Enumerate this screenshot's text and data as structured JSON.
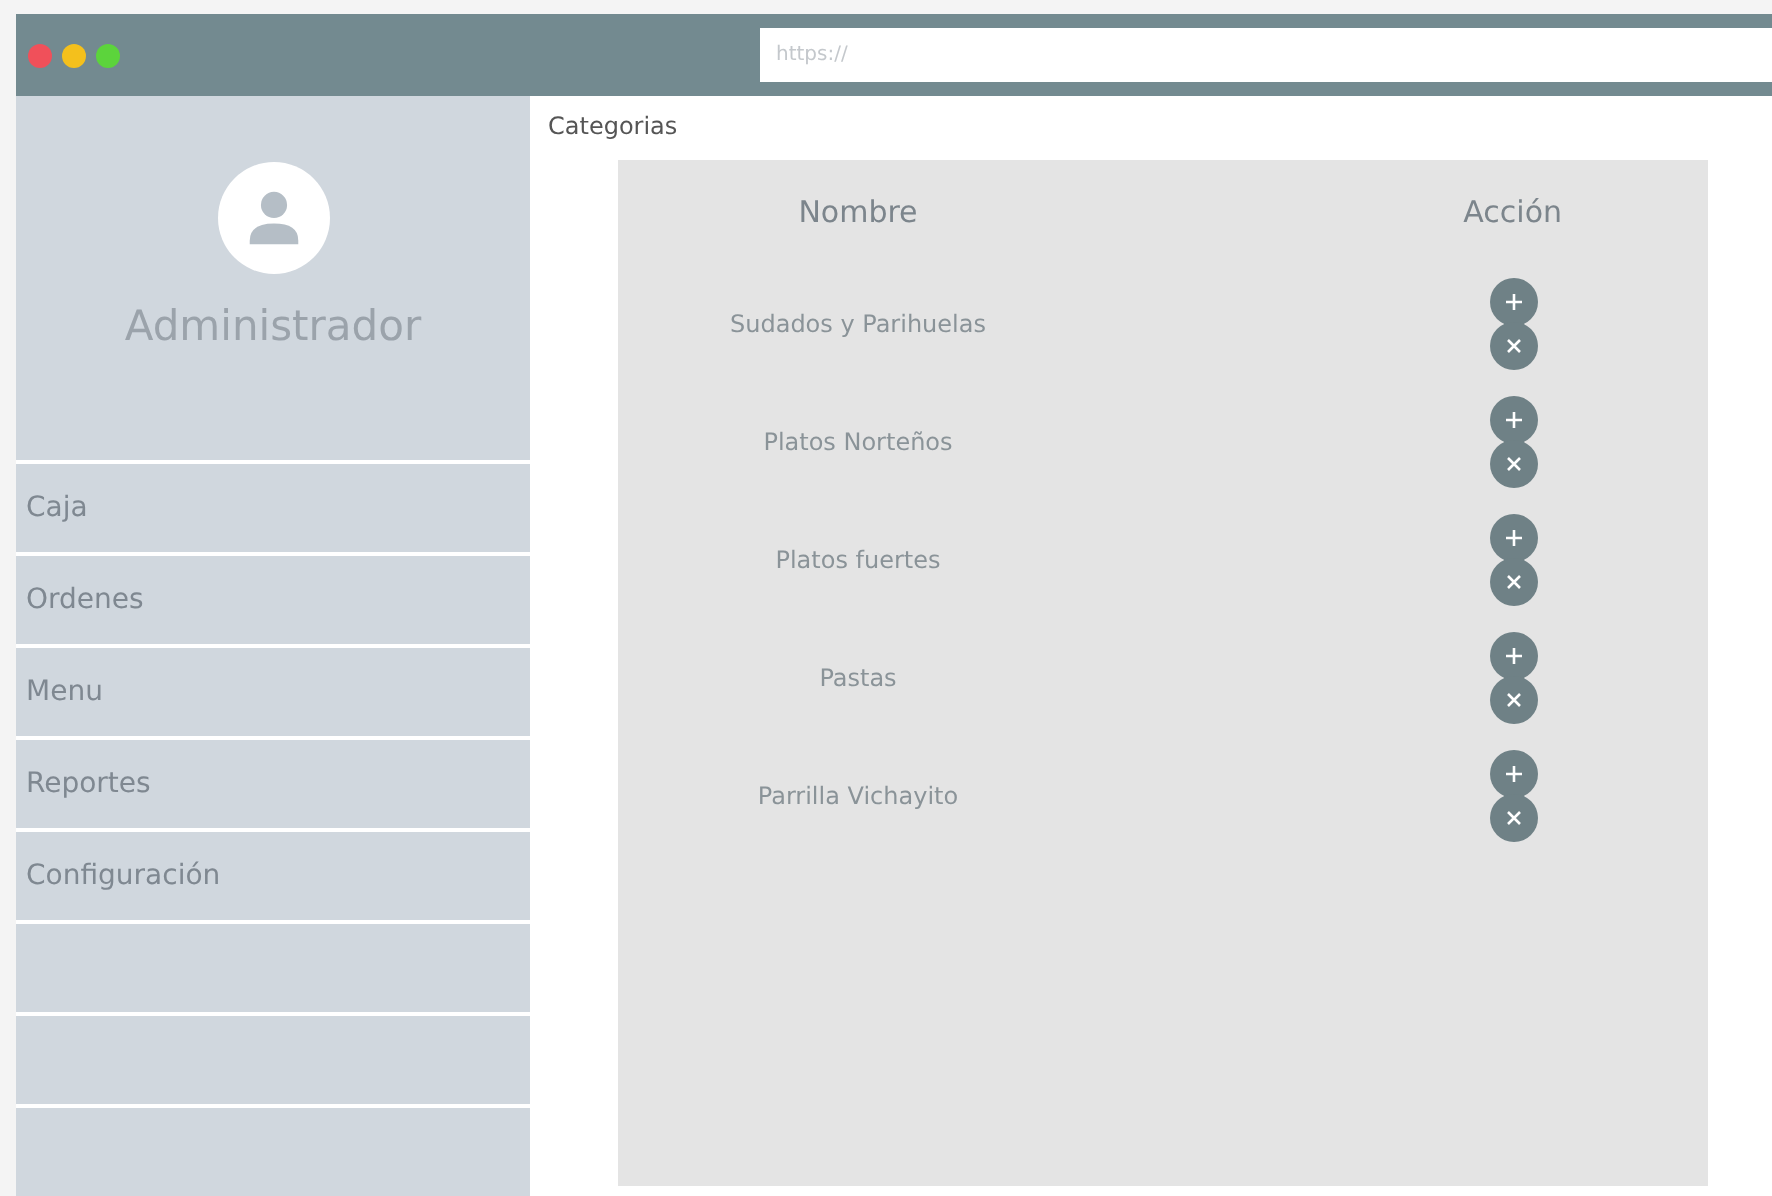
{
  "window": {
    "url_placeholder": "https://"
  },
  "sidebar": {
    "user": "Administrador",
    "items": [
      {
        "label": "Caja"
      },
      {
        "label": "Ordenes"
      },
      {
        "label": "Menu"
      },
      {
        "label": "Reportes"
      },
      {
        "label": "Configuración"
      }
    ]
  },
  "breadcrumb": "Categorias",
  "table": {
    "columns": [
      "Nombre",
      "Acción"
    ],
    "rows": [
      {
        "name": "Sudados y Parihuelas"
      },
      {
        "name": "Platos Norteños"
      },
      {
        "name": "Platos fuertes"
      },
      {
        "name": "Pastas"
      },
      {
        "name": "Parrilla Vichayito"
      }
    ]
  }
}
